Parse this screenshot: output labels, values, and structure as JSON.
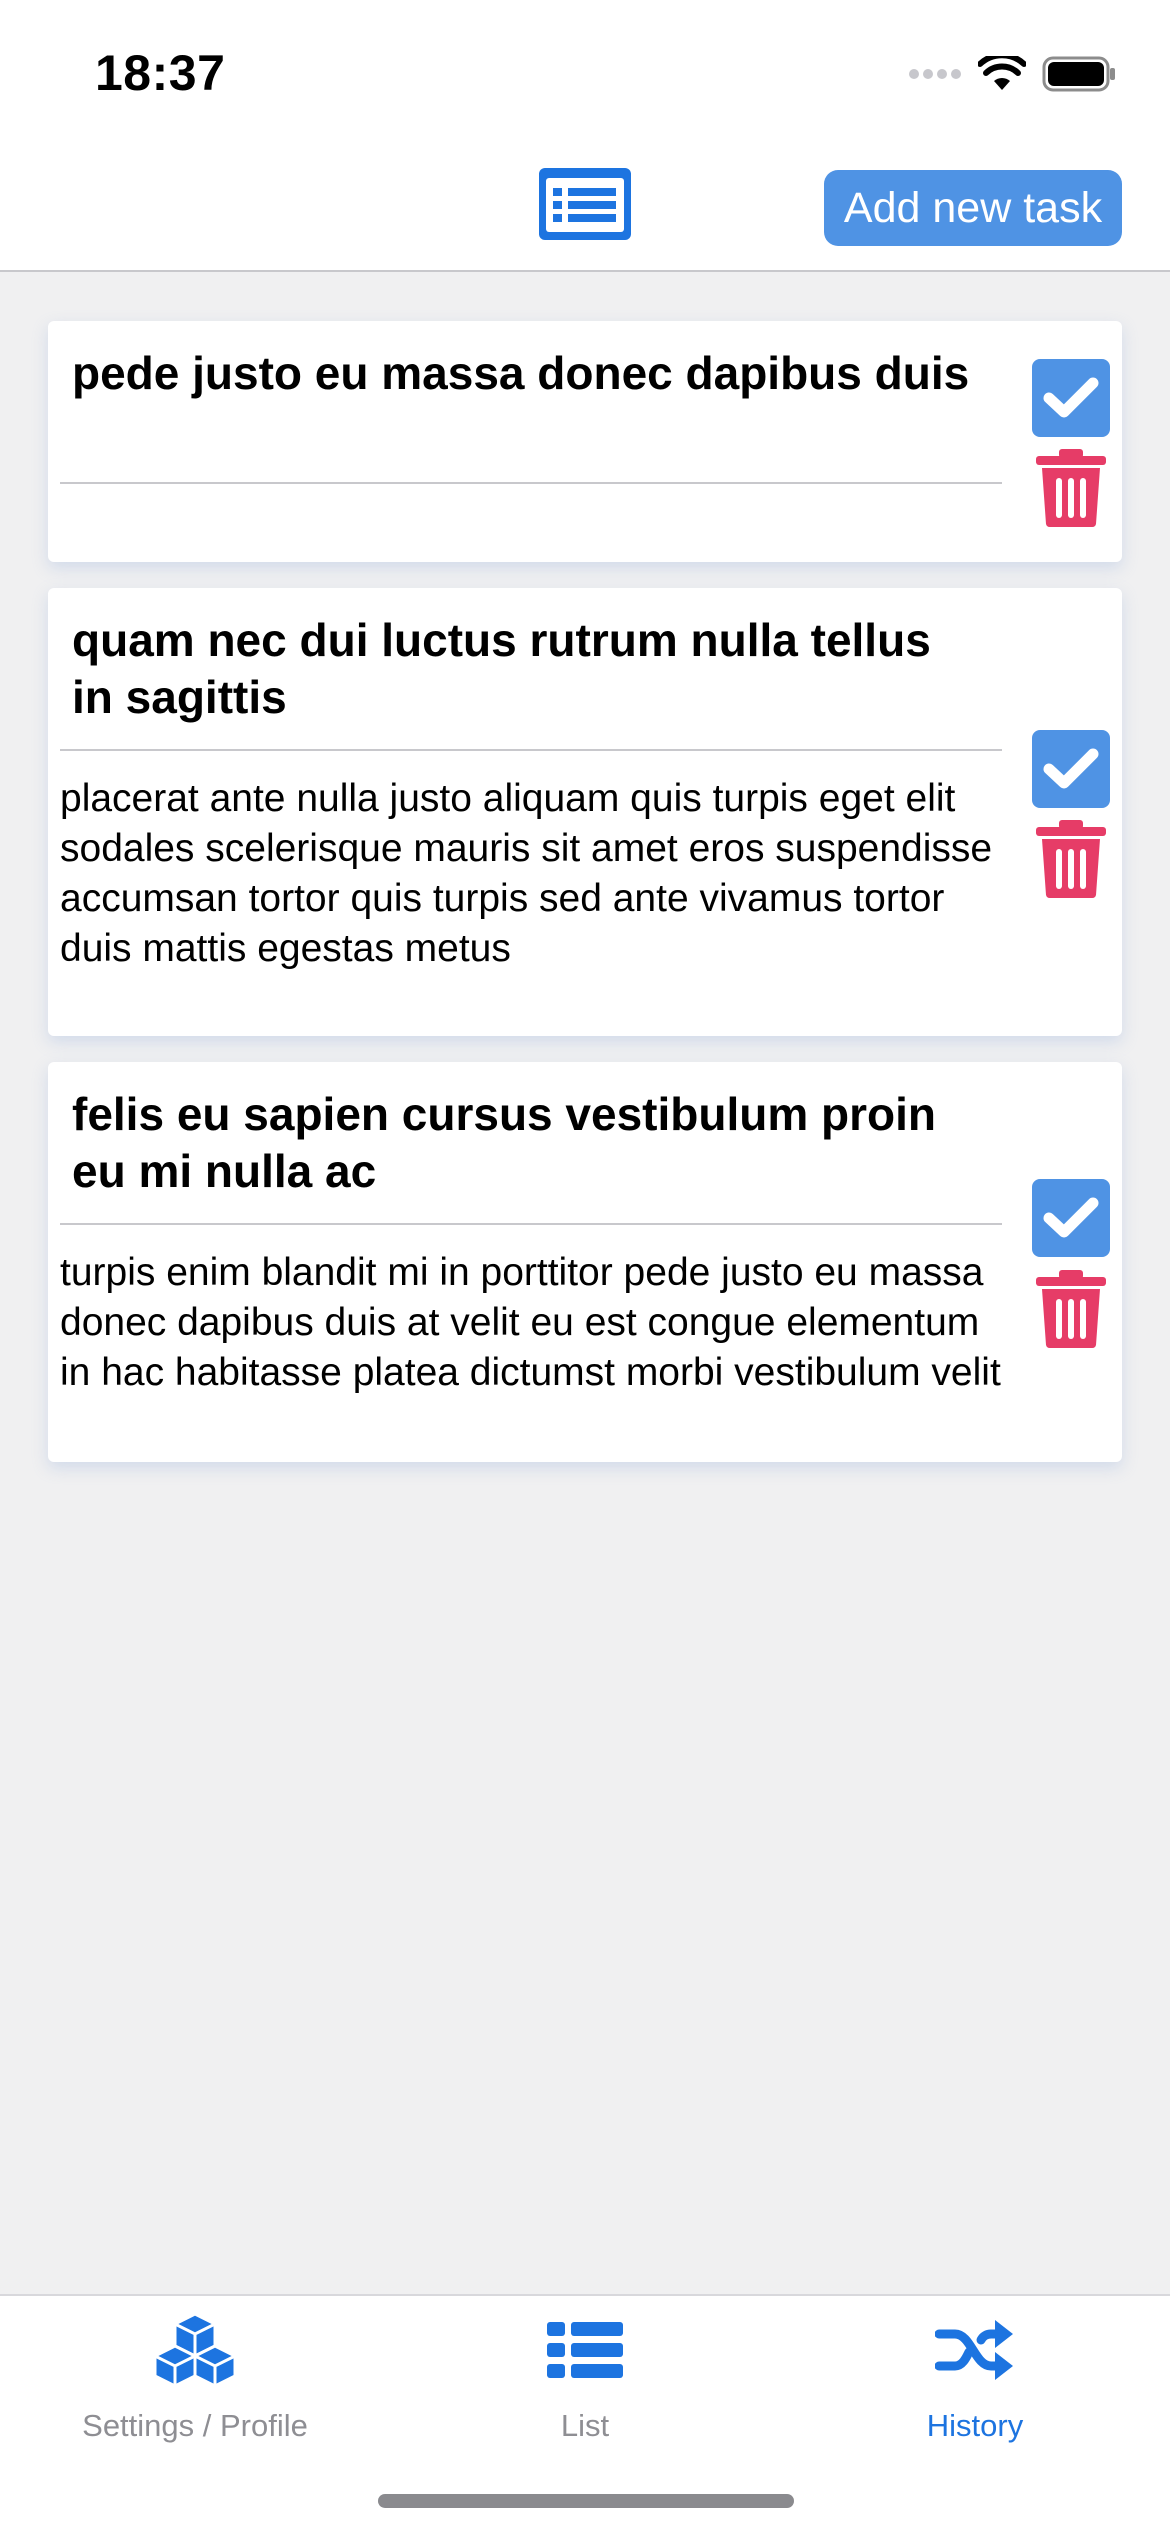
{
  "status_bar": {
    "time": "18:37"
  },
  "header": {
    "center_icon": "list-alt-icon",
    "add_button_label": "Add new task"
  },
  "tasks": [
    {
      "title": "pede justo eu massa donec dapibus duis",
      "description": "",
      "check_icon": "check-square-icon",
      "delete_icon": "trash-icon"
    },
    {
      "title": "quam nec dui luctus rutrum nulla tellus in sagittis",
      "description": "placerat ante nulla justo aliquam quis turpis eget elit sodales scelerisque mauris sit amet eros suspendisse accumsan tortor quis turpis sed ante vivamus tortor duis mattis egestas metus",
      "check_icon": "check-square-icon",
      "delete_icon": "trash-icon"
    },
    {
      "title": "felis eu sapien cursus vestibulum proin eu mi nulla ac",
      "description": "turpis enim blandit mi in porttitor pede justo eu massa donec dapibus duis at velit eu est congue elementum in hac habitasse platea dictumst morbi vestibulum velit",
      "check_icon": "check-square-icon",
      "delete_icon": "trash-icon"
    }
  ],
  "tab_bar": {
    "active_tab": "History",
    "tabs": [
      {
        "label": "Settings / Profile",
        "icon": "cubes-icon"
      },
      {
        "label": "List",
        "icon": "list-icon"
      },
      {
        "label": "History",
        "icon": "random-icon"
      }
    ]
  },
  "colors": {
    "accent": "#4f93e4",
    "active_tab": "#1d74e0",
    "delete": "#e63c67",
    "background": "#f0f0f1"
  }
}
